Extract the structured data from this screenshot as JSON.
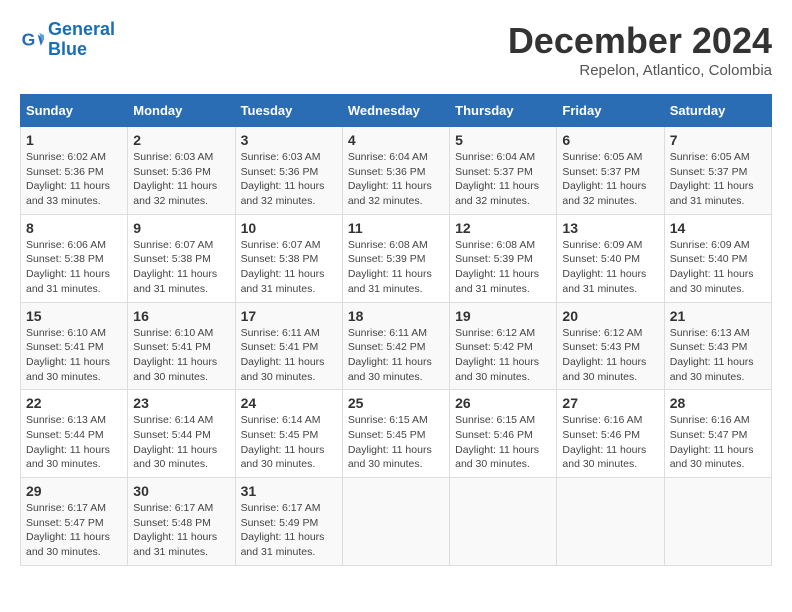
{
  "logo": {
    "line1": "General",
    "line2": "Blue"
  },
  "title": "December 2024",
  "subtitle": "Repelon, Atlantico, Colombia",
  "days_header": [
    "Sunday",
    "Monday",
    "Tuesday",
    "Wednesday",
    "Thursday",
    "Friday",
    "Saturday"
  ],
  "weeks": [
    [
      {
        "day": "1",
        "info": "Sunrise: 6:02 AM\nSunset: 5:36 PM\nDaylight: 11 hours\nand 33 minutes."
      },
      {
        "day": "2",
        "info": "Sunrise: 6:03 AM\nSunset: 5:36 PM\nDaylight: 11 hours\nand 32 minutes."
      },
      {
        "day": "3",
        "info": "Sunrise: 6:03 AM\nSunset: 5:36 PM\nDaylight: 11 hours\nand 32 minutes."
      },
      {
        "day": "4",
        "info": "Sunrise: 6:04 AM\nSunset: 5:36 PM\nDaylight: 11 hours\nand 32 minutes."
      },
      {
        "day": "5",
        "info": "Sunrise: 6:04 AM\nSunset: 5:37 PM\nDaylight: 11 hours\nand 32 minutes."
      },
      {
        "day": "6",
        "info": "Sunrise: 6:05 AM\nSunset: 5:37 PM\nDaylight: 11 hours\nand 32 minutes."
      },
      {
        "day": "7",
        "info": "Sunrise: 6:05 AM\nSunset: 5:37 PM\nDaylight: 11 hours\nand 31 minutes."
      }
    ],
    [
      {
        "day": "8",
        "info": "Sunrise: 6:06 AM\nSunset: 5:38 PM\nDaylight: 11 hours\nand 31 minutes."
      },
      {
        "day": "9",
        "info": "Sunrise: 6:07 AM\nSunset: 5:38 PM\nDaylight: 11 hours\nand 31 minutes."
      },
      {
        "day": "10",
        "info": "Sunrise: 6:07 AM\nSunset: 5:38 PM\nDaylight: 11 hours\nand 31 minutes."
      },
      {
        "day": "11",
        "info": "Sunrise: 6:08 AM\nSunset: 5:39 PM\nDaylight: 11 hours\nand 31 minutes."
      },
      {
        "day": "12",
        "info": "Sunrise: 6:08 AM\nSunset: 5:39 PM\nDaylight: 11 hours\nand 31 minutes."
      },
      {
        "day": "13",
        "info": "Sunrise: 6:09 AM\nSunset: 5:40 PM\nDaylight: 11 hours\nand 31 minutes."
      },
      {
        "day": "14",
        "info": "Sunrise: 6:09 AM\nSunset: 5:40 PM\nDaylight: 11 hours\nand 30 minutes."
      }
    ],
    [
      {
        "day": "15",
        "info": "Sunrise: 6:10 AM\nSunset: 5:41 PM\nDaylight: 11 hours\nand 30 minutes."
      },
      {
        "day": "16",
        "info": "Sunrise: 6:10 AM\nSunset: 5:41 PM\nDaylight: 11 hours\nand 30 minutes."
      },
      {
        "day": "17",
        "info": "Sunrise: 6:11 AM\nSunset: 5:41 PM\nDaylight: 11 hours\nand 30 minutes."
      },
      {
        "day": "18",
        "info": "Sunrise: 6:11 AM\nSunset: 5:42 PM\nDaylight: 11 hours\nand 30 minutes."
      },
      {
        "day": "19",
        "info": "Sunrise: 6:12 AM\nSunset: 5:42 PM\nDaylight: 11 hours\nand 30 minutes."
      },
      {
        "day": "20",
        "info": "Sunrise: 6:12 AM\nSunset: 5:43 PM\nDaylight: 11 hours\nand 30 minutes."
      },
      {
        "day": "21",
        "info": "Sunrise: 6:13 AM\nSunset: 5:43 PM\nDaylight: 11 hours\nand 30 minutes."
      }
    ],
    [
      {
        "day": "22",
        "info": "Sunrise: 6:13 AM\nSunset: 5:44 PM\nDaylight: 11 hours\nand 30 minutes."
      },
      {
        "day": "23",
        "info": "Sunrise: 6:14 AM\nSunset: 5:44 PM\nDaylight: 11 hours\nand 30 minutes."
      },
      {
        "day": "24",
        "info": "Sunrise: 6:14 AM\nSunset: 5:45 PM\nDaylight: 11 hours\nand 30 minutes."
      },
      {
        "day": "25",
        "info": "Sunrise: 6:15 AM\nSunset: 5:45 PM\nDaylight: 11 hours\nand 30 minutes."
      },
      {
        "day": "26",
        "info": "Sunrise: 6:15 AM\nSunset: 5:46 PM\nDaylight: 11 hours\nand 30 minutes."
      },
      {
        "day": "27",
        "info": "Sunrise: 6:16 AM\nSunset: 5:46 PM\nDaylight: 11 hours\nand 30 minutes."
      },
      {
        "day": "28",
        "info": "Sunrise: 6:16 AM\nSunset: 5:47 PM\nDaylight: 11 hours\nand 30 minutes."
      }
    ],
    [
      {
        "day": "29",
        "info": "Sunrise: 6:17 AM\nSunset: 5:47 PM\nDaylight: 11 hours\nand 30 minutes."
      },
      {
        "day": "30",
        "info": "Sunrise: 6:17 AM\nSunset: 5:48 PM\nDaylight: 11 hours\nand 31 minutes."
      },
      {
        "day": "31",
        "info": "Sunrise: 6:17 AM\nSunset: 5:49 PM\nDaylight: 11 hours\nand 31 minutes."
      },
      {
        "day": "",
        "info": ""
      },
      {
        "day": "",
        "info": ""
      },
      {
        "day": "",
        "info": ""
      },
      {
        "day": "",
        "info": ""
      }
    ]
  ]
}
